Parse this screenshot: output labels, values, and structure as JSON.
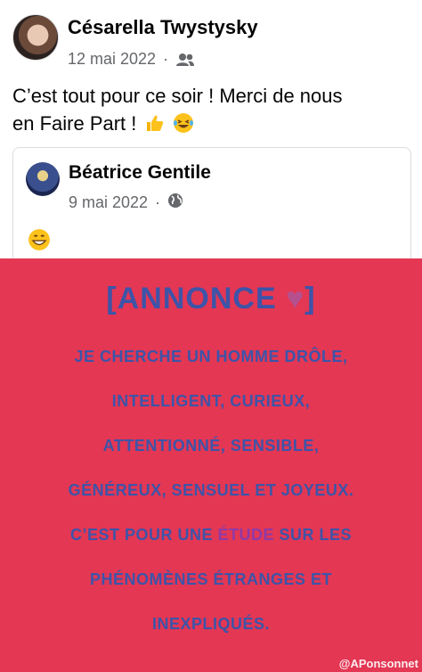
{
  "post": {
    "author": "Césarella Twystysky",
    "date": "12 mai 2022",
    "separator": "·",
    "audience_icon": "friends-icon",
    "text_line1": "C’est tout pour ce soir ! Merci de nous",
    "text_line2": "en Faire Part !",
    "emojis": [
      "thumbs-up-icon",
      "laughing-tears-icon"
    ]
  },
  "shared": {
    "author": "Béatrice Gentile",
    "date": "9 mai 2022",
    "separator": "·",
    "audience_icon": "globe-icon",
    "emoji": "grinning-icon"
  },
  "annonce": {
    "title": "[ANNONCE ",
    "title_heart": "♥",
    "title_close": "]",
    "lines": [
      "JE CHERCHE UN HOMME DRÔLE,",
      "INTELLIGENT, CURIEUX,",
      "ATTENTIONNÉ, SENSIBLE,",
      "GÉNÉREUX, SENSUEL ET JOYEUX.",
      "C’EST POUR UNE ",
      "PHÉNOMÈNES ÉTRANGES ET",
      "INEXPLIQUÉS."
    ],
    "line5_highlight": "ÉTUDE",
    "line5_end": " SUR LES",
    "credit": "@APonsonnet",
    "colors": {
      "background": "#e33754",
      "text": "#3d54a8",
      "highlight": "#8f3aa6"
    }
  }
}
